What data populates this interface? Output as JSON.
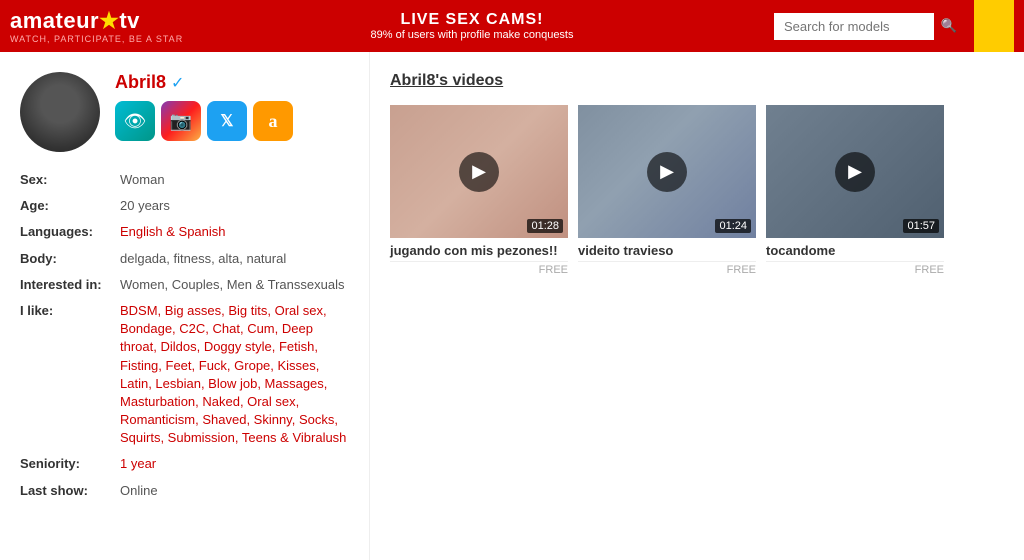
{
  "header": {
    "logo_title": "amateur★tv",
    "logo_subtitle": "WATCH, PARTICIPATE, BE A STAR",
    "live_cams_title": "LIVE SEX CAMS!",
    "live_cams_subtitle": "89% of users with profile make conquests",
    "search_placeholder": "Search for models",
    "search_icon": "🔍"
  },
  "profile": {
    "name": "Abril8",
    "verified": "✓",
    "social_icons": [
      {
        "id": "eye",
        "label": "eye-icon",
        "symbol": "👁"
      },
      {
        "id": "instagram",
        "label": "instagram-icon",
        "symbol": "📷"
      },
      {
        "id": "twitter",
        "label": "twitter-icon",
        "symbol": "𝕏"
      },
      {
        "id": "amazon",
        "label": "amazon-icon",
        "symbol": "a"
      }
    ],
    "fields": [
      {
        "label": "Sex:",
        "value": "Woman",
        "link": false
      },
      {
        "label": "Age:",
        "value": "20 years",
        "link": false
      },
      {
        "label": "Languages:",
        "value": "English & Spanish",
        "link": true
      },
      {
        "label": "Body:",
        "value": "delgada, fitness, alta, natural",
        "link": false
      },
      {
        "label": "Interested in:",
        "value": "Women, Couples, Men & Transsexuals",
        "link": false
      },
      {
        "label": "I like:",
        "value": "BDSM, Big asses, Big tits, Oral sex, Bondage, C2C, Chat, Cum, Deep throat, Dildos, Doggy style, Fetish, Fisting, Feet, Fuck, Grope, Kisses, Latin, Lesbian, Blow job, Massages, Masturbation, Naked, Oral sex, Romanticism, Shaved, Skinny, Socks, Squirts, Submission, Teens & Vibralush",
        "link": true
      },
      {
        "label": "Seniority:",
        "value": "1 year",
        "link": true
      },
      {
        "label": "Last show:",
        "value": "Online",
        "link": false
      }
    ]
  },
  "videos": {
    "section_title": "Abril8's videos",
    "items": [
      {
        "title": "jugando con mis pezones!!",
        "duration": "01:28",
        "free": "FREE",
        "thumb_class": "video-thumb-1"
      },
      {
        "title": "videito travieso",
        "duration": "01:24",
        "free": "FREE",
        "thumb_class": "video-thumb-2"
      },
      {
        "title": "tocandome",
        "duration": "01:57",
        "free": "FREE",
        "thumb_class": "video-thumb-3"
      }
    ],
    "play_symbol": "▶"
  }
}
